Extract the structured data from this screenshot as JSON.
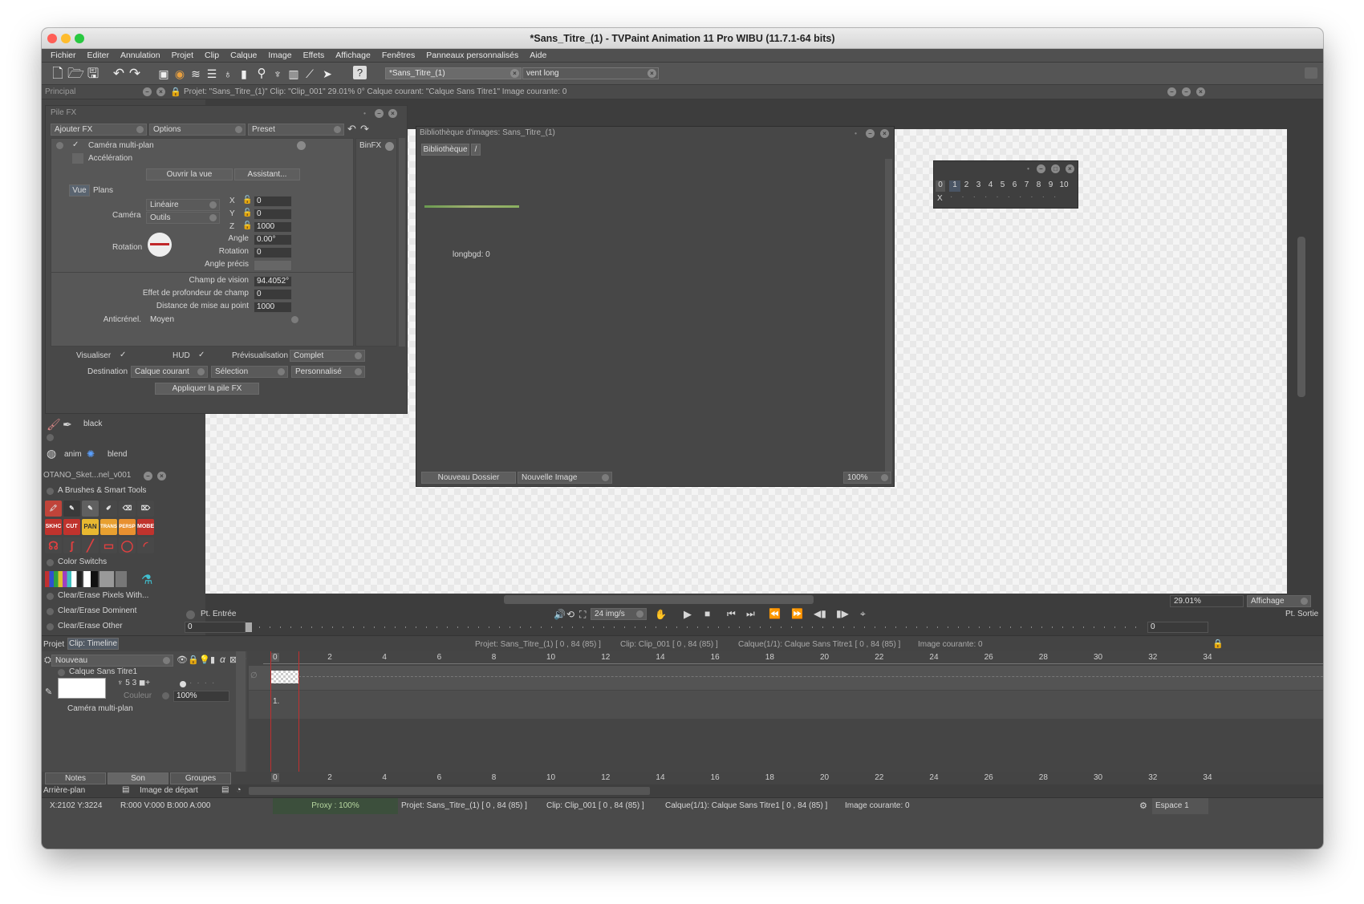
{
  "window": {
    "title": "*Sans_Titre_(1) - TVPaint Animation 11 Pro WIBU (11.7.1-64 bits)"
  },
  "menu": [
    "Fichier",
    "Editer",
    "Annulation",
    "Projet",
    "Clip",
    "Calque",
    "Image",
    "Effets",
    "Affichage",
    "Fenêtres",
    "Panneaux personnalisés",
    "Aide"
  ],
  "toolbar": {
    "project_tab": "*Sans_Titre_(1)",
    "second_tab": "vent long"
  },
  "principal": {
    "title": "Principal",
    "info": "Projet: \"Sans_Titre_(1)\" Clip: \"Clip_001\"  29.01%  0°  Calque courant: \"Calque Sans Titre1\"  Image courante: 0"
  },
  "pile_fx": {
    "title": "Pile FX",
    "add_fx": "Ajouter FX",
    "options": "Options",
    "preset": "Preset",
    "effect_name": "Caméra multi-plan",
    "acceleration": "Accélération",
    "binfx": "BinFX",
    "open_view": "Ouvrir la vue",
    "assistant": "Assistant...",
    "tab_vue": "Vue",
    "tab_plans": "Plans",
    "camera_label": "Caméra",
    "camera_mode": "Linéaire",
    "camera_tools": "Outils",
    "x_label": "X",
    "x_value": "0",
    "y_label": "Y",
    "y_value": "0",
    "z_label": "Z",
    "z_value": "1000",
    "rotation_label": "Rotation",
    "angle_label": "Angle",
    "angle_value": "0.00°",
    "rotation_sub_label": "Rotation",
    "rotation_value": "0",
    "precise_angle_label": "Angle précis",
    "fov_label": "Champ de vision",
    "fov_value": "94.4052°",
    "dof_label": "Effet de profondeur de champ",
    "dof_value": "0",
    "focus_label": "Distance de mise au point",
    "focus_value": "1000",
    "antialias_label": "Anticrénel.",
    "antialias_value": "Moyen",
    "visualize": "Visualiser",
    "hud": "HUD",
    "preview_label": "Prévisualisation",
    "preview_value": "Complet",
    "destination_label": "Destination",
    "destination_value": "Calque courant",
    "selection": "Sélection",
    "custom": "Personnalisé",
    "apply": "Appliquer la pile FX"
  },
  "brush_panel": {
    "color_name": "black",
    "anim": "anim",
    "blend": "blend"
  },
  "otano_panel": {
    "title": "OTANO_Sket...nel_v001",
    "section1": "A Brushes & Smart Tools",
    "tools_row2": [
      "SKHC",
      "CUT B",
      "PAN",
      "TRANS",
      "PERSP",
      "MOBE"
    ],
    "section2": "Color Switchs",
    "items": [
      "Clear/Erase Pixels With...",
      "Clear/Erase Dominent",
      "Clear/Erase Other"
    ]
  },
  "library": {
    "title": "Bibliothèque d'images: Sans_Titre_(1)",
    "tab": "Bibliothèque",
    "path": "/",
    "item_label": "longbgd: 0",
    "new_folder": "Nouveau Dossier",
    "new_image": "Nouvelle Image",
    "zoom": "100%"
  },
  "xsheet": {
    "frames": [
      "0",
      "1",
      "2",
      "3",
      "4",
      "5",
      "6",
      "7",
      "8",
      "9",
      "10"
    ],
    "marker": "X"
  },
  "playback": {
    "in_point": "Pt. Entrée",
    "in_value": "0",
    "fps": "24 img/s",
    "zoom": "29.01%",
    "display": "Affichage",
    "out_point": "Pt. Sortie",
    "out_value": "0"
  },
  "timeline": {
    "tab_project": "Projet",
    "tab_clip": "Clip: Timeline",
    "info_project": "Projet: Sans_Titre_(1) [ 0 , 84  (85) ]",
    "info_clip": "Clip: Clip_001 [ 0 , 84  (85) ]",
    "info_layer": "Calque(1/1): Calque Sans Titre1 [ 0 , 84  (85) ]",
    "info_frame": "Image courante: 0",
    "new_layer": "Nouveau",
    "layer_name": "Calque Sans Titre1",
    "layer_mode": "Couleur",
    "layer_opacity": "100%",
    "layer_fx": "Caméra multi-plan",
    "frame_label": "1.",
    "ruler": [
      "0",
      "2",
      "4",
      "6",
      "8",
      "10",
      "12",
      "14",
      "16",
      "18",
      "20",
      "22",
      "24",
      "26",
      "28",
      "30",
      "32",
      "34"
    ],
    "tab_notes": "Notes",
    "tab_sound": "Son",
    "tab_groups": "Groupes",
    "background": "Arrière-plan",
    "start_image": "Image de départ"
  },
  "status": {
    "coords": "X:2102  Y:3224",
    "rgba": "R:000 V:000 B:000 A:000",
    "proxy": "Proxy : 100%",
    "project": "Projet: Sans_Titre_(1) [ 0 , 84  (85) ]",
    "clip": "Clip: Clip_001 [ 0 , 84  (85) ]",
    "layer": "Calque(1/1): Calque Sans Titre1 [ 0 , 84  (85) ]",
    "frame": "Image courante: 0",
    "workspace": "Espace 1"
  }
}
